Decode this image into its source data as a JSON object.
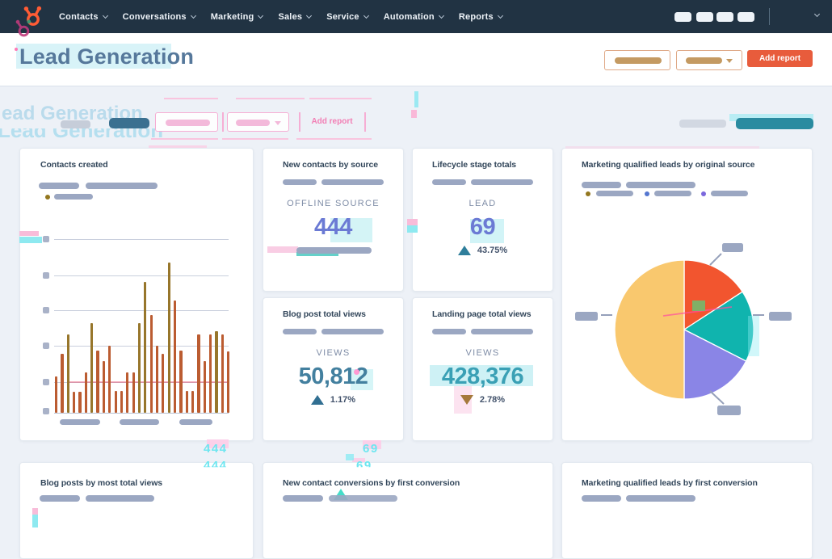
{
  "nav": {
    "items": [
      {
        "label": "Contacts"
      },
      {
        "label": "Conversations"
      },
      {
        "label": "Marketing"
      },
      {
        "label": "Sales"
      },
      {
        "label": "Service"
      },
      {
        "label": "Automation"
      },
      {
        "label": "Reports"
      }
    ]
  },
  "header": {
    "title": "Lead Generation",
    "add_report_label": "Add report"
  },
  "glitch": {
    "ghost_title_line1": "ead Generation",
    "ghost_title_line2": "Lead Generation",
    "ghost_add_report": "Add report",
    "ghost_value_1": "444",
    "ghost_value_1b": "444",
    "ghost_value_2": "69",
    "ghost_value_2b": "69"
  },
  "cards": {
    "contacts_created": {
      "title": "Contacts created"
    },
    "new_contacts_by_source": {
      "title": "New contacts by source",
      "label": "OFFLINE SOURCE",
      "value": "444"
    },
    "lifecycle_stage_totals": {
      "title": "Lifecycle stage totals",
      "label": "LEAD",
      "value": "69",
      "change": "43.75%",
      "direction": "up"
    },
    "mql_by_original_source": {
      "title": "Marketing qualified leads by original source"
    },
    "blog_post_total_views": {
      "title": "Blog post total views",
      "label": "VIEWS",
      "value": "50,812",
      "change": "1.17%",
      "direction": "up"
    },
    "landing_page_total_views": {
      "title": "Landing page total views",
      "label": "VIEWS",
      "value": "428,376",
      "change": "2.78%",
      "direction": "down"
    },
    "blog_posts_by_most_total_views": {
      "title": "Blog posts by most total views"
    },
    "new_contact_conversions": {
      "title": "New contact conversions by first conversion"
    },
    "mql_by_first_conversion": {
      "title": "Marketing qualified leads by first conversion"
    }
  },
  "colors": {
    "nav_bg": "#213343",
    "hubspot_orange": "#ff5c35",
    "add_report_button": "#e85c3c",
    "periwinkle_value": "#6b7ad4",
    "steel_blue_value": "#43809f",
    "teal_value": "#3aa0b5",
    "placeholder_gray": "#9ba7c2",
    "bar_orange": "#bb5c31",
    "bar_olive": "#97762b",
    "pie_amber": "#f9c86e",
    "pie_red": "#f2552f",
    "pie_teal": "#10b4ae",
    "pie_purple": "#8a85e6",
    "glitch_cyan": "#6fe6f0",
    "glitch_pink": "#f6aed4"
  },
  "chart_data": [
    {
      "type": "bar",
      "title": "Contacts created",
      "note": "axis labels are placeholder bars; values are relative bar heights in px (gridline spacing ~44px, baseline 0)",
      "values": [
        45,
        73,
        97,
        26,
        26,
        50,
        111,
        77,
        64,
        83,
        27,
        27,
        50,
        50,
        111,
        162,
        121,
        83,
        73,
        186,
        139,
        77,
        27,
        27,
        97,
        64,
        97,
        101,
        97,
        76
      ],
      "bar_color": "#bb5c31",
      "alt_bar_color": "#97762b",
      "olive_indices": [
        2,
        6,
        14,
        15,
        19,
        27
      ],
      "gridlines": 5,
      "x_axis_label_placeholders": 3,
      "legend": [
        {
          "dot_color": "#93771f",
          "label": "placeholder"
        }
      ]
    },
    {
      "type": "pie",
      "title": "Marketing qualified leads by original source",
      "start_at_deg": 0,
      "slices": [
        {
          "name": "slice-red",
          "angle_deg": 57,
          "share_pct": 15.8,
          "color": "#f2552f"
        },
        {
          "name": "slice-teal",
          "angle_deg": 60,
          "share_pct": 16.7,
          "color": "#10b4ae"
        },
        {
          "name": "slice-purple",
          "angle_deg": 63,
          "share_pct": 17.5,
          "color": "#8a85e6"
        },
        {
          "name": "slice-amber",
          "angle_deg": 180,
          "share_pct": 50.0,
          "color": "#f9c86e"
        }
      ],
      "legend": [
        {
          "dot_color": "#93771f",
          "label": "placeholder"
        },
        {
          "dot_color": "#5577d0",
          "label": "placeholder"
        },
        {
          "dot_color": "#7b68dd",
          "label": "placeholder"
        }
      ],
      "callout_labels": "4 placeholder labels with connector lines"
    },
    {
      "type": "metric",
      "title": "New contacts by source",
      "label": "OFFLINE SOURCE",
      "value": 444
    },
    {
      "type": "metric",
      "title": "Lifecycle stage totals",
      "label": "LEAD",
      "value": 69,
      "change_pct": 43.75,
      "direction": "up"
    },
    {
      "type": "metric",
      "title": "Blog post total views",
      "label": "VIEWS",
      "value": 50812,
      "change_pct": 1.17,
      "direction": "up"
    },
    {
      "type": "metric",
      "title": "Landing page total views",
      "label": "VIEWS",
      "value": 428376,
      "change_pct": 2.78,
      "direction": "down"
    }
  ]
}
